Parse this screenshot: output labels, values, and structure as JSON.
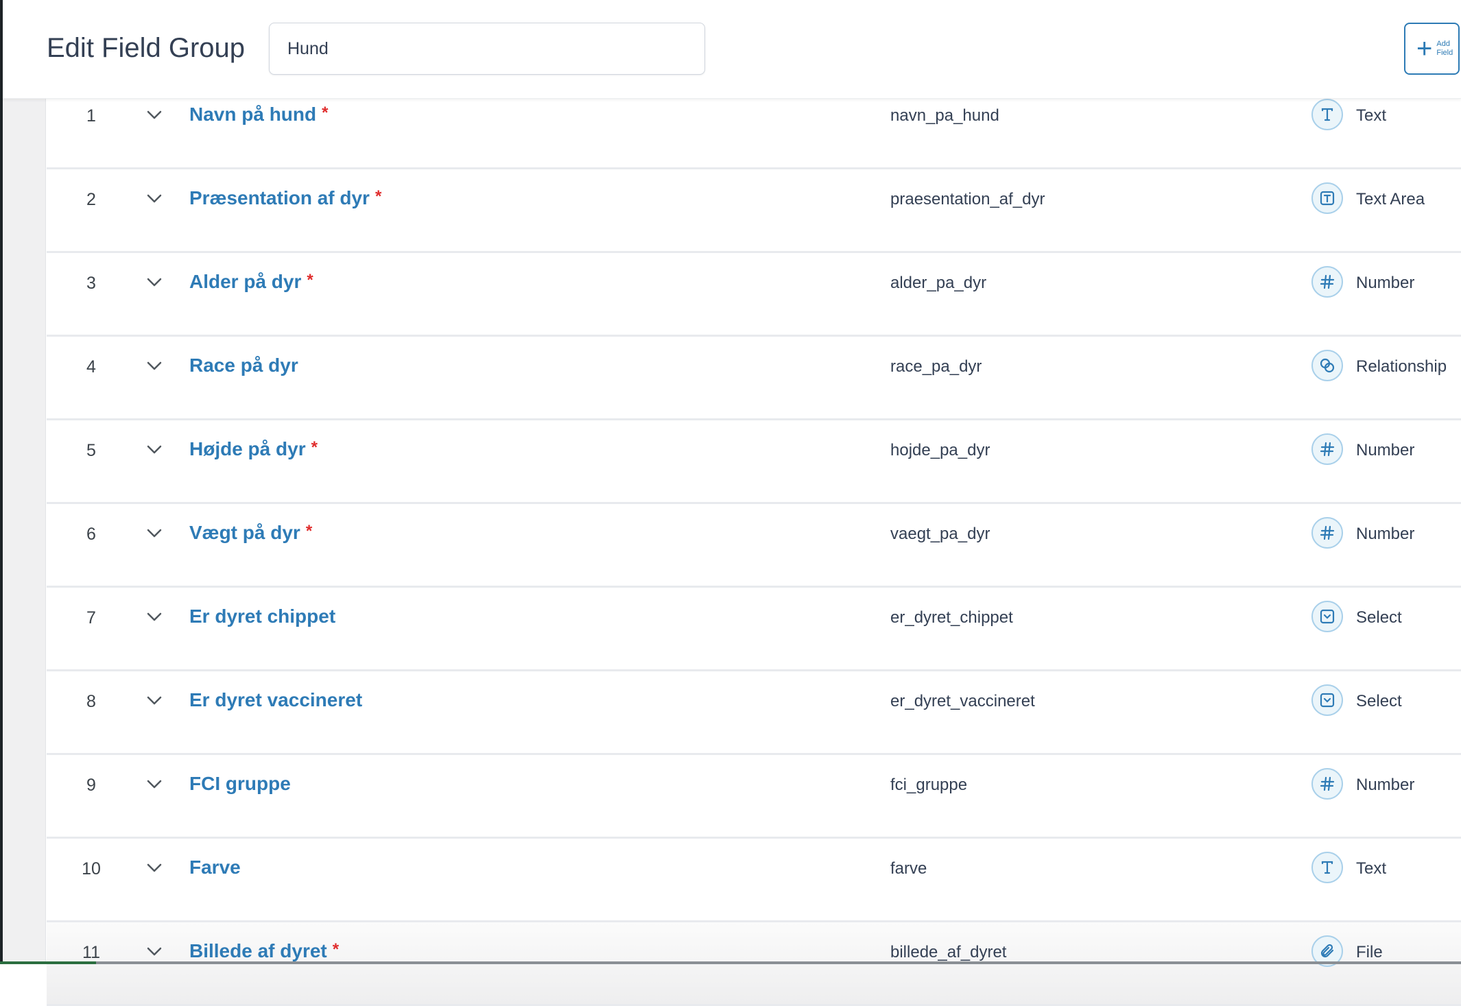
{
  "header": {
    "title": "Edit Field Group",
    "group_name": "Hund",
    "add_button_label": "Add Field"
  },
  "colors": {
    "accent": "#2e7bb6",
    "required": "#e02c2c"
  },
  "fields": [
    {
      "order": "1",
      "label": "Navn på hund",
      "required": true,
      "name": "navn_pa_hund",
      "type": "Text",
      "icon": "text-icon"
    },
    {
      "order": "2",
      "label": "Præsentation af dyr",
      "required": true,
      "name": "praesentation_af_dyr",
      "type": "Text Area",
      "icon": "textarea-icon"
    },
    {
      "order": "3",
      "label": "Alder på dyr",
      "required": true,
      "name": "alder_pa_dyr",
      "type": "Number",
      "icon": "number-icon"
    },
    {
      "order": "4",
      "label": "Race på dyr",
      "required": false,
      "name": "race_pa_dyr",
      "type": "Relationship",
      "icon": "relationship-icon"
    },
    {
      "order": "5",
      "label": "Højde på dyr",
      "required": true,
      "name": "hojde_pa_dyr",
      "type": "Number",
      "icon": "number-icon"
    },
    {
      "order": "6",
      "label": "Vægt på dyr",
      "required": true,
      "name": "vaegt_pa_dyr",
      "type": "Number",
      "icon": "number-icon"
    },
    {
      "order": "7",
      "label": "Er dyret chippet",
      "required": false,
      "name": "er_dyret_chippet",
      "type": "Select",
      "icon": "select-icon"
    },
    {
      "order": "8",
      "label": "Er dyret vaccineret",
      "required": false,
      "name": "er_dyret_vaccineret",
      "type": "Select",
      "icon": "select-icon"
    },
    {
      "order": "9",
      "label": "FCI gruppe",
      "required": false,
      "name": "fci_gruppe",
      "type": "Number",
      "icon": "number-icon"
    },
    {
      "order": "10",
      "label": "Farve",
      "required": false,
      "name": "farve",
      "type": "Text",
      "icon": "text-icon"
    },
    {
      "order": "11",
      "label": "Billede af dyret",
      "required": true,
      "name": "billede_af_dyret",
      "type": "File",
      "icon": "file-icon"
    }
  ],
  "required_mark": "*"
}
